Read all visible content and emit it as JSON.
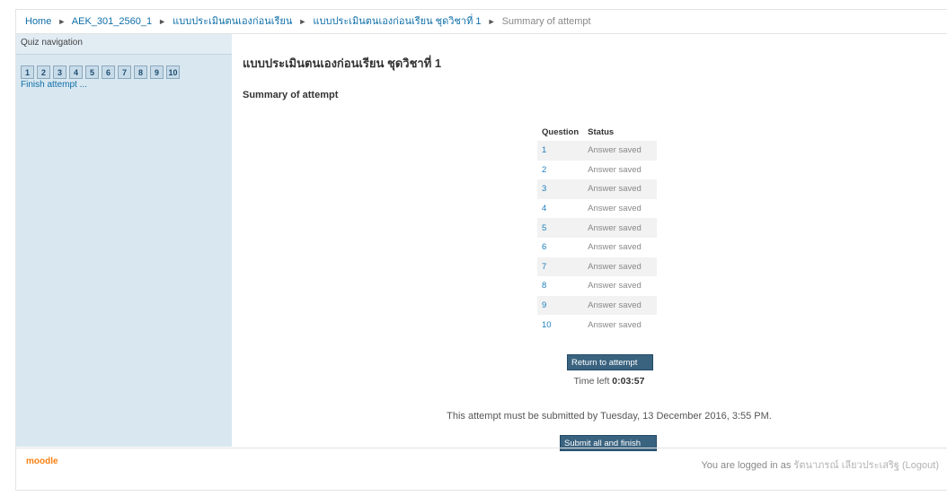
{
  "breadcrumb": {
    "items": [
      "Home",
      "AEK_301_2560_1",
      "แบบประเมินตนเองก่อนเรียน",
      "แบบประเมินตนเองก่อนเรียน ชุดวิชาที่ 1",
      "Summary of attempt"
    ],
    "separator": "►"
  },
  "quiz_navigation": {
    "title": "Quiz navigation",
    "buttons": [
      "1",
      "2",
      "3",
      "4",
      "5",
      "6",
      "7",
      "8",
      "9",
      "10"
    ],
    "finish_label": "Finish attempt ..."
  },
  "main": {
    "quiz_title": "แบบประเมินตนเองก่อนเรียน ชุดวิชาที่ 1",
    "summary_title": "Summary of attempt",
    "table": {
      "headers": [
        "Question",
        "Status"
      ],
      "rows": [
        {
          "question": "1",
          "status": "Answer saved"
        },
        {
          "question": "2",
          "status": "Answer saved"
        },
        {
          "question": "3",
          "status": "Answer saved"
        },
        {
          "question": "4",
          "status": "Answer saved"
        },
        {
          "question": "5",
          "status": "Answer saved"
        },
        {
          "question": "6",
          "status": "Answer saved"
        },
        {
          "question": "7",
          "status": "Answer saved"
        },
        {
          "question": "8",
          "status": "Answer saved"
        },
        {
          "question": "9",
          "status": "Answer saved"
        },
        {
          "question": "10",
          "status": "Answer saved"
        }
      ]
    },
    "return_button": "Return to attempt",
    "time_left_label": "Time left",
    "time_left_value": "0:03:57",
    "deadline_text": "This attempt must be submitted by Tuesday, 13 December 2016, 3:55 PM.",
    "submit_button": "Submit all and finish"
  },
  "footer": {
    "logo": "moodle",
    "logged_in_prefix": "You are logged in as",
    "user_name": "รัตนาภรณ์ เลียวประเสริฐ",
    "logout_label": "(Logout)"
  },
  "colors": {
    "sidebar_bg": "#d9e7f0",
    "button_bg": "#3a6380",
    "link": "#1e80bd",
    "moodle_orange": "#f98012"
  }
}
